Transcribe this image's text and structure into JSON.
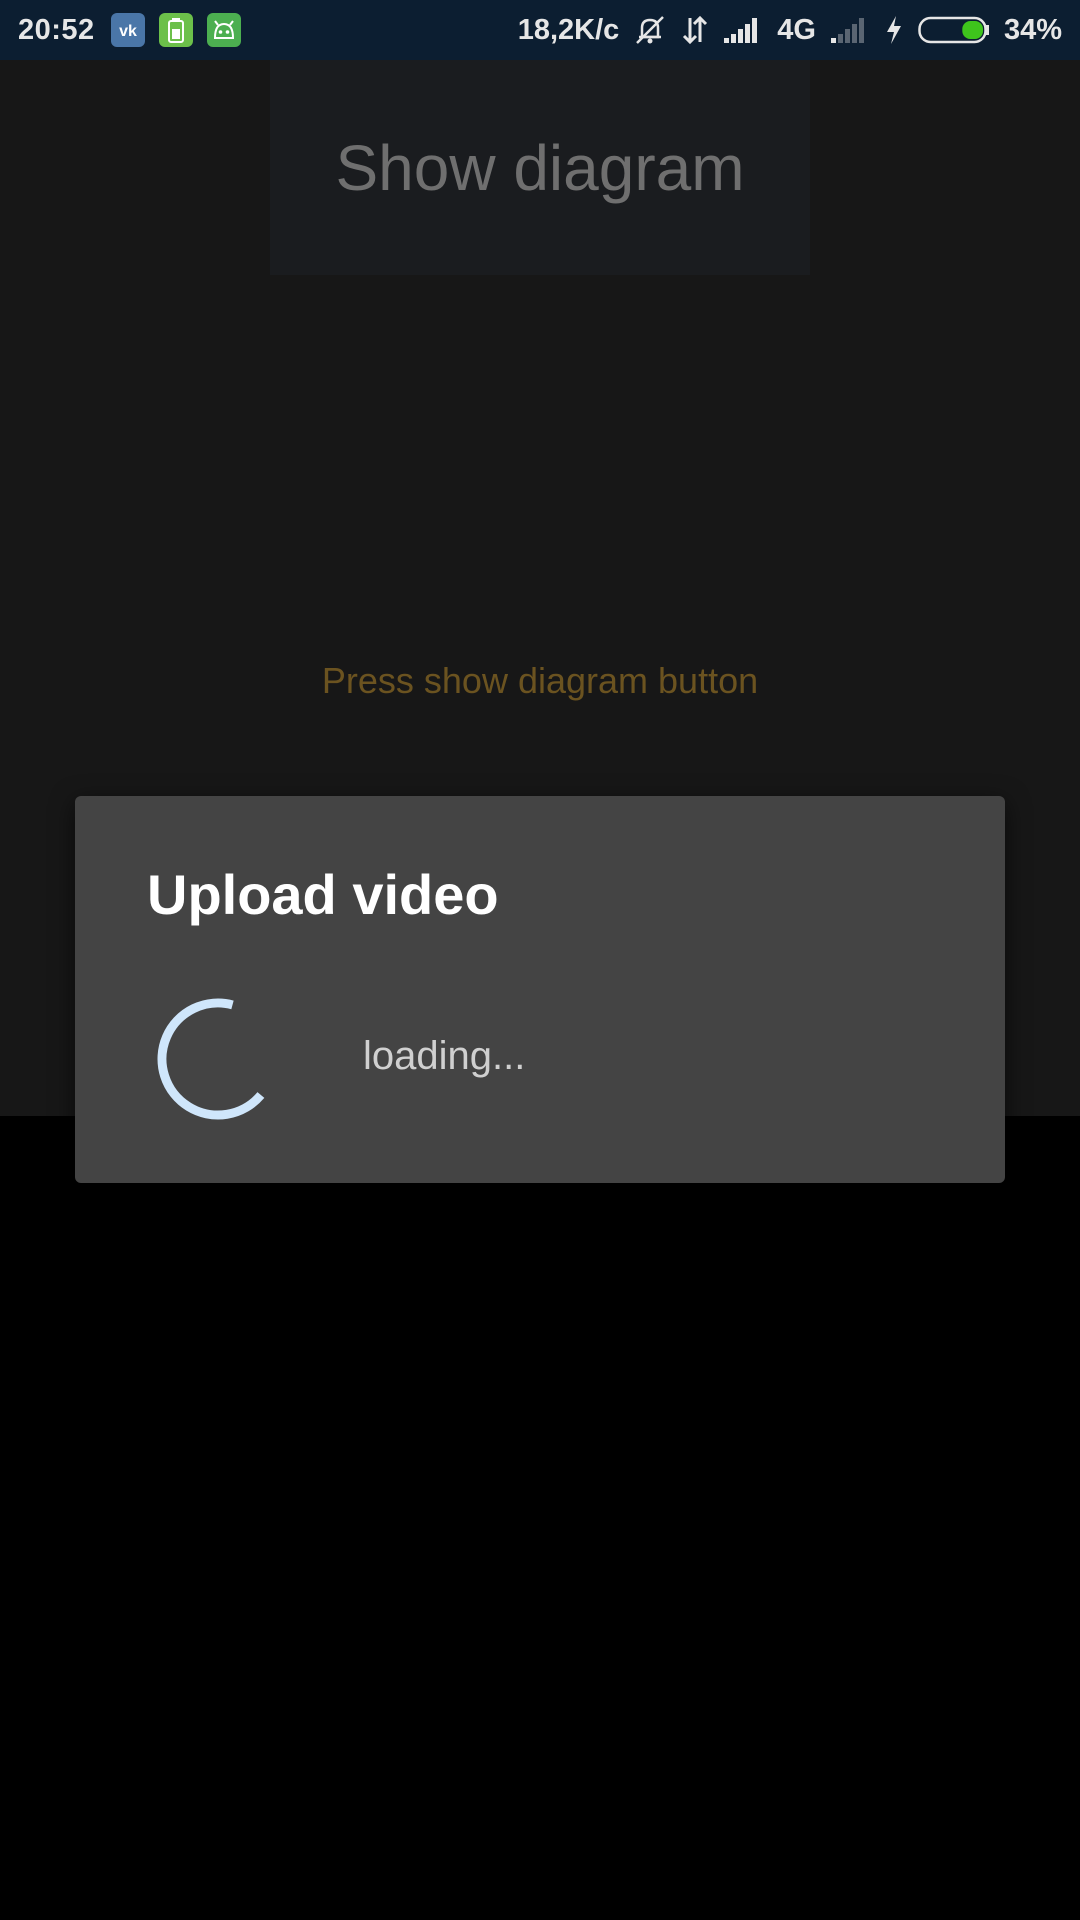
{
  "status_bar": {
    "time": "20:52",
    "apps": [
      "vk-icon",
      "battery-app-icon",
      "android-app-icon"
    ],
    "net_speed": "18,2K/c",
    "network_type": "4G",
    "battery_percent": "34%",
    "battery_level": 0.34,
    "background_color": "#0c1e31"
  },
  "main": {
    "show_diagram_label": "Show diagram",
    "hint": "Press show diagram button"
  },
  "dialog": {
    "title": "Upload video",
    "loading_text": "loading...",
    "spinner_color": "#cfe6fb"
  },
  "colors": {
    "dialog_bg": "#444444",
    "hint_color": "#6b5320",
    "app_bg": "#171717"
  }
}
